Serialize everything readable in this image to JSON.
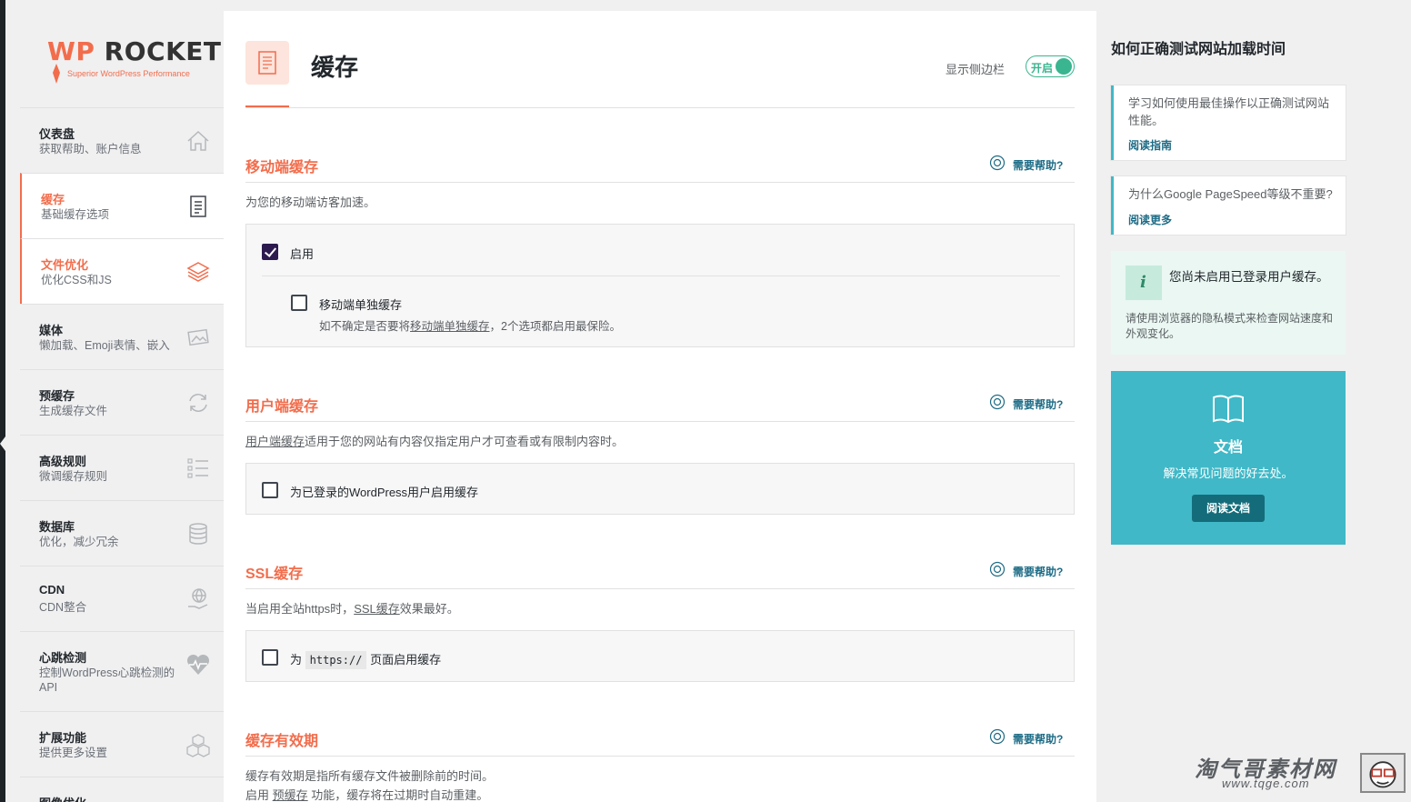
{
  "brand": {
    "word_wp": "WP",
    "word_rocket": "ROCKET",
    "tagline": "Superior WordPress Performance"
  },
  "nav": [
    {
      "title": "仪表盘",
      "subtitle": "获取帮助、账户信息",
      "icon": "home-icon"
    },
    {
      "title": "缓存",
      "subtitle": "基础缓存选项",
      "icon": "file-icon",
      "active": true
    },
    {
      "title": "文件优化",
      "subtitle": "优化CSS和JS",
      "icon": "layers-icon",
      "highlight": true
    },
    {
      "title": "媒体",
      "subtitle": "懒加载、Emoji表情、嵌入",
      "icon": "image-icon"
    },
    {
      "title": "预缓存",
      "subtitle": "生成缓存文件",
      "icon": "refresh-icon"
    },
    {
      "title": "高级规则",
      "subtitle": "微调缓存规则",
      "icon": "list-icon"
    },
    {
      "title": "数据库",
      "subtitle": "优化，减少冗余",
      "icon": "database-icon"
    },
    {
      "title": "CDN",
      "subtitle": "CDN整合",
      "icon": "globe-hand-icon"
    },
    {
      "title": "心跳检测",
      "subtitle": "控制WordPress心跳检测的API",
      "icon": "heart-icon"
    },
    {
      "title": "扩展功能",
      "subtitle": "提供更多设置",
      "icon": "cubes-icon"
    },
    {
      "title": "图像优化",
      "subtitle": "",
      "icon": ""
    }
  ],
  "header": {
    "title": "缓存",
    "sidebar_toggle_label": "显示侧边栏",
    "sidebar_toggle_state": "开启"
  },
  "help_label": "需要帮助?",
  "sections": {
    "mobile": {
      "title": "移动端缓存",
      "desc": "为您的移动端访客加速。",
      "enable_label": "启用",
      "enable_checked": true,
      "separate_label": "移动端单独缓存",
      "separate_checked": false,
      "separate_hint_pre": "如不确定是否要将",
      "separate_hint_link": "移动端单独缓存",
      "separate_hint_post": "，2个选项都启用最保险。"
    },
    "user": {
      "title": "用户端缓存",
      "desc_link": "用户端缓存",
      "desc_rest": "适用于您的网站有内容仅指定用户才可查看或有限制内容时。",
      "option_label": "为已登录的WordPress用户启用缓存",
      "option_checked": false
    },
    "ssl": {
      "title": "SSL缓存",
      "desc_pre": "当启用全站https时，",
      "desc_link": "SSL缓存",
      "desc_post": "效果最好。",
      "option_pre": "为",
      "option_code": "https://",
      "option_post": "页面启用缓存",
      "option_checked": false
    },
    "lifespan": {
      "title": "缓存有效期",
      "desc1": "缓存有效期是指所有缓存文件被删除前的时间。",
      "desc2_pre": "启用",
      "desc2_link": "预缓存",
      "desc2_post": "功能，缓存将在过期时自动重建。"
    }
  },
  "aside": {
    "title": "如何正确测试网站加载时间",
    "cards": [
      {
        "text": "学习如何使用最佳操作以正确测试网站性能。",
        "link": "阅读指南"
      },
      {
        "text": "为什么Google PageSpeed等级不重要?",
        "link": "阅读更多"
      }
    ],
    "notice": {
      "title": "您尚未启用已登录用户缓存。",
      "desc": "请使用浏览器的隐私模式来检查网站速度和外观变化。"
    },
    "docs": {
      "title": "文档",
      "subtitle": "解决常见问题的好去处。",
      "button": "阅读文档"
    }
  },
  "watermark": {
    "text": "淘气哥素材网",
    "url": "www.tqge.com"
  },
  "colors": {
    "accent": "#f26d4c",
    "teal": "#40b8c7",
    "green": "#39b58f",
    "link": "#1e6c86"
  }
}
